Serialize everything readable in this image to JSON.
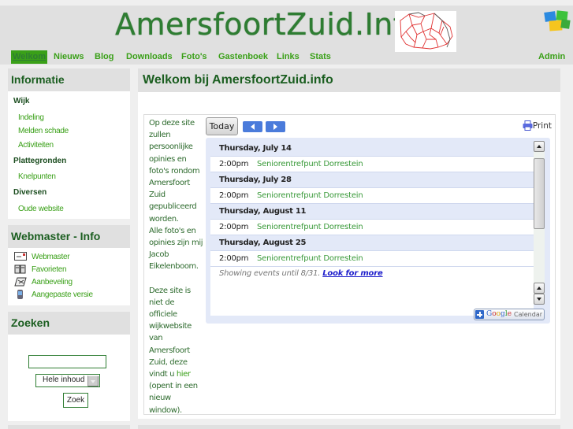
{
  "header": {
    "site_title": "AmersfoortZuid.Info",
    "logo_alt": "map-logo",
    "corner_icon": "photo-gallery-icon"
  },
  "nav": {
    "items": [
      {
        "label": "Welkom",
        "active": true
      },
      {
        "label": "Nieuws"
      },
      {
        "label": "Blog"
      },
      {
        "label": "Downloads"
      },
      {
        "label": "Foto's"
      },
      {
        "label": "Gastenboek"
      },
      {
        "label": "Links"
      },
      {
        "label": "Stats"
      }
    ],
    "admin": "Admin"
  },
  "sidebar": {
    "informatie": {
      "title": "Informatie",
      "groups": [
        {
          "label": "Wijk",
          "links": [
            "Indeling",
            "Melden schade",
            "Activiteiten"
          ]
        },
        {
          "label": "Plattegronden",
          "links": [
            "Knelpunten"
          ]
        },
        {
          "label": "Diversen",
          "links": [
            "Oude website"
          ]
        }
      ]
    },
    "webmaster": {
      "title": "Webmaster - Info",
      "items": [
        {
          "label": "Webmaster",
          "icon": "mail-icon"
        },
        {
          "label": "Favorieten",
          "icon": "book-icon"
        },
        {
          "label": "Aanbeveling",
          "icon": "recommend-icon"
        },
        {
          "label": "Aangepaste versie",
          "icon": "mobile-icon"
        }
      ]
    },
    "search": {
      "title": "Zoeken",
      "input_value": "",
      "scope_selected": "Hele inhoud",
      "button": "Zoek"
    }
  },
  "main": {
    "title": "Welkom bij AmersfoortZuid.info",
    "intro_p1": "Op deze site zullen persoonlijke opinies en foto's rondom Amersfoort Zuid gepubliceerd worden.",
    "intro_p2": "Alle foto's en opinies zijn mij Jacob Eikelenboom.",
    "intro_p3_before": "Deze site is niet de officiele wijkwebsite van Amersfoort Zuid, deze vindt u ",
    "intro_p3_link": "hier",
    "intro_p3_after": " (opent in een nieuw window).",
    "calendar": {
      "today_label": "Today",
      "print_label": "Print",
      "days": [
        {
          "date": "Thursday, July 14",
          "events": [
            {
              "time": "2:00pm",
              "title": "Seniorentrefpunt Dorrestein"
            }
          ]
        },
        {
          "date": "Thursday, July 28",
          "events": [
            {
              "time": "2:00pm",
              "title": "Seniorentrefpunt Dorrestein"
            }
          ]
        },
        {
          "date": "Thursday, August 11",
          "events": [
            {
              "time": "2:00pm",
              "title": "Seniorentrefpunt Dorrestein"
            }
          ]
        },
        {
          "date": "Thursday, August 25",
          "events": [
            {
              "time": "2:00pm",
              "title": "Seniorentrefpunt Dorrestein"
            }
          ]
        }
      ],
      "showing_text": "Showing events until 8/31. ",
      "look_more": "Look for more",
      "gcal_word": "Calendar"
    }
  },
  "colors": {
    "accent_green": "#3aa018",
    "heading_green": "#1b5e20",
    "calendar_bg": "#e3e9f8",
    "nav_button_blue": "#4a7bdb"
  }
}
